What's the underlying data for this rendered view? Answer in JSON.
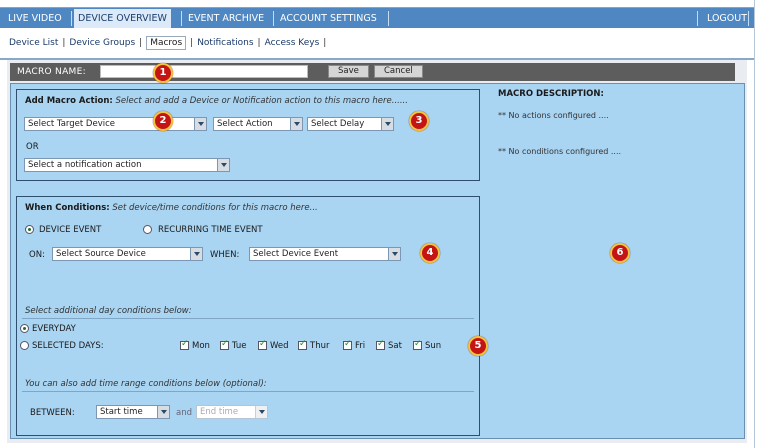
{
  "topnav": {
    "items": [
      {
        "label": "LIVE VIDEO"
      },
      {
        "label": "DEVICE OVERVIEW"
      },
      {
        "label": "EVENT ARCHIVE"
      },
      {
        "label": "ACCOUNT SETTINGS"
      }
    ],
    "logout": "LOGOUT"
  },
  "subnav": {
    "tabs": [
      {
        "label": "Device List"
      },
      {
        "label": "Device Groups"
      },
      {
        "label": "Macros"
      },
      {
        "label": "Notifications"
      },
      {
        "label": "Access Keys"
      }
    ]
  },
  "macro": {
    "name_label": "MACRO NAME:",
    "name_value": "",
    "save": "Save",
    "cancel": "Cancel"
  },
  "action_box": {
    "title": "Add Macro Action:",
    "subtitle": "Select and add a Device or Notification action to this macro here......",
    "target_device": "Select Target Device",
    "action": "Select Action",
    "delay": "Select Delay",
    "or": "OR",
    "notification": "Select a notification action"
  },
  "conditions_box": {
    "title": "When Conditions:",
    "subtitle": "Set device/time conditions for this macro here...",
    "radio_device_event": "DEVICE EVENT",
    "radio_recurring": "RECURRING TIME EVENT",
    "on_label": "ON:",
    "source_device": "Select Source Device",
    "when_label": "WHEN:",
    "device_event": "Select Device Event",
    "day_conditions_note": "Select additional day conditions below:",
    "everyday": "EVERYDAY",
    "selected_days": "SELECTED DAYS:",
    "days": [
      "Mon",
      "Tue",
      "Wed",
      "Thur",
      "Fri",
      "Sat",
      "Sun"
    ],
    "time_note": "You can also add time range conditions below (optional):",
    "between_label": "BETWEEN:",
    "start_time": "Start time",
    "and_label": "and",
    "end_time": "End time"
  },
  "description": {
    "title": "MACRO DESCRIPTION:",
    "no_actions": "** No actions configured ....",
    "no_conditions": "** No conditions configured ...."
  },
  "callouts": [
    "1",
    "2",
    "3",
    "4",
    "5",
    "6"
  ],
  "colors": {
    "nav_blue": "#4f87c3",
    "panel_blue": "#a9d4f2",
    "callout_red": "#c41414",
    "callout_ring": "#f2c440"
  }
}
